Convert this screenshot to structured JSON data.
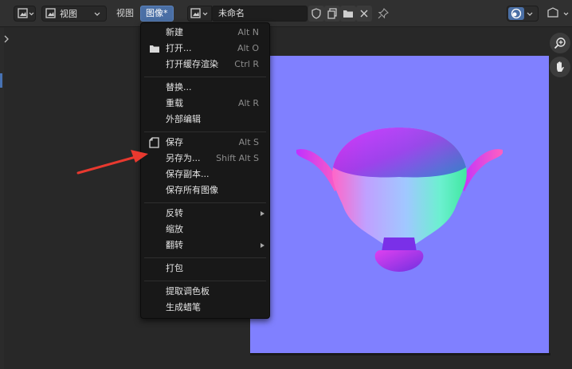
{
  "header": {
    "view_menu_label": "视图",
    "view_label": "视图",
    "image_menu_label": "图像*",
    "image_name": "未命名"
  },
  "image_menu": {
    "items": [
      {
        "label": "新建",
        "shortcut": "Alt N"
      },
      {
        "label": "打开...",
        "shortcut": "Alt O"
      },
      {
        "label": "打开缓存渲染",
        "shortcut": "Ctrl R"
      },
      {
        "label": "替换...",
        "shortcut": ""
      },
      {
        "label": "重载",
        "shortcut": "Alt R"
      },
      {
        "label": "外部编辑",
        "shortcut": ""
      },
      {
        "label": "保存",
        "shortcut": "Alt S"
      },
      {
        "label": "另存为...",
        "shortcut": "Shift Alt S"
      },
      {
        "label": "保存副本...",
        "shortcut": ""
      },
      {
        "label": "保存所有图像",
        "shortcut": ""
      },
      {
        "label": "反转",
        "shortcut": ""
      },
      {
        "label": "缩放",
        "shortcut": ""
      },
      {
        "label": "翻转",
        "shortcut": ""
      },
      {
        "label": "打包",
        "shortcut": ""
      },
      {
        "label": "提取调色板",
        "shortcut": ""
      },
      {
        "label": "生成蜡笔",
        "shortcut": ""
      }
    ]
  },
  "icons": [
    "editor-type-icon",
    "image-icon",
    "image-browse-icon",
    "shield-icon",
    "duplicate-icon",
    "folder-icon",
    "close-icon",
    "pin-icon",
    "overlay-icon",
    "zoom-icon",
    "hand-icon",
    "collapse-icon"
  ],
  "colors": {
    "accent": "#4a6fa5",
    "canvas_background": "#8080ff",
    "arrow": "#e8392f"
  }
}
